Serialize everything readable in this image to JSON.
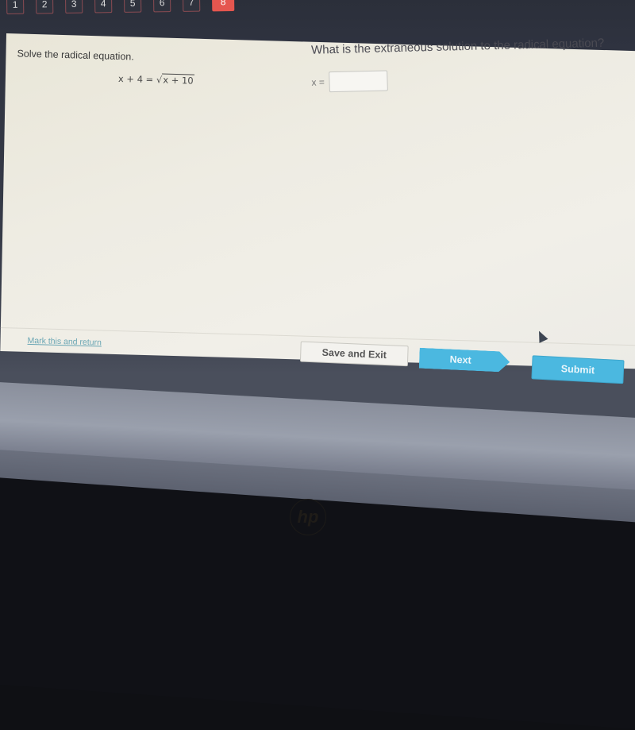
{
  "question_nav": {
    "items": [
      "1",
      "2",
      "3",
      "4",
      "5",
      "6",
      "7",
      "8"
    ],
    "active_index": 7
  },
  "question": {
    "prompt": "Solve the radical equation.",
    "equation_lhs": "x + 4 = ",
    "equation_radical_symbol": "√",
    "equation_radicand": "x + 10",
    "sub_question": "What is the extraneous solution to the radical equation?",
    "answer_label": "x =",
    "answer_value": "",
    "answer_placeholder": ""
  },
  "footer": {
    "mark_link": "Mark this and return",
    "save_exit": "Save and Exit",
    "next": "Next",
    "submit": "Submit"
  },
  "device": {
    "logo": "hp"
  },
  "colors": {
    "active_tab": "#e5564f",
    "primary_button": "#4bb8e0",
    "link": "#6aa6b4"
  }
}
